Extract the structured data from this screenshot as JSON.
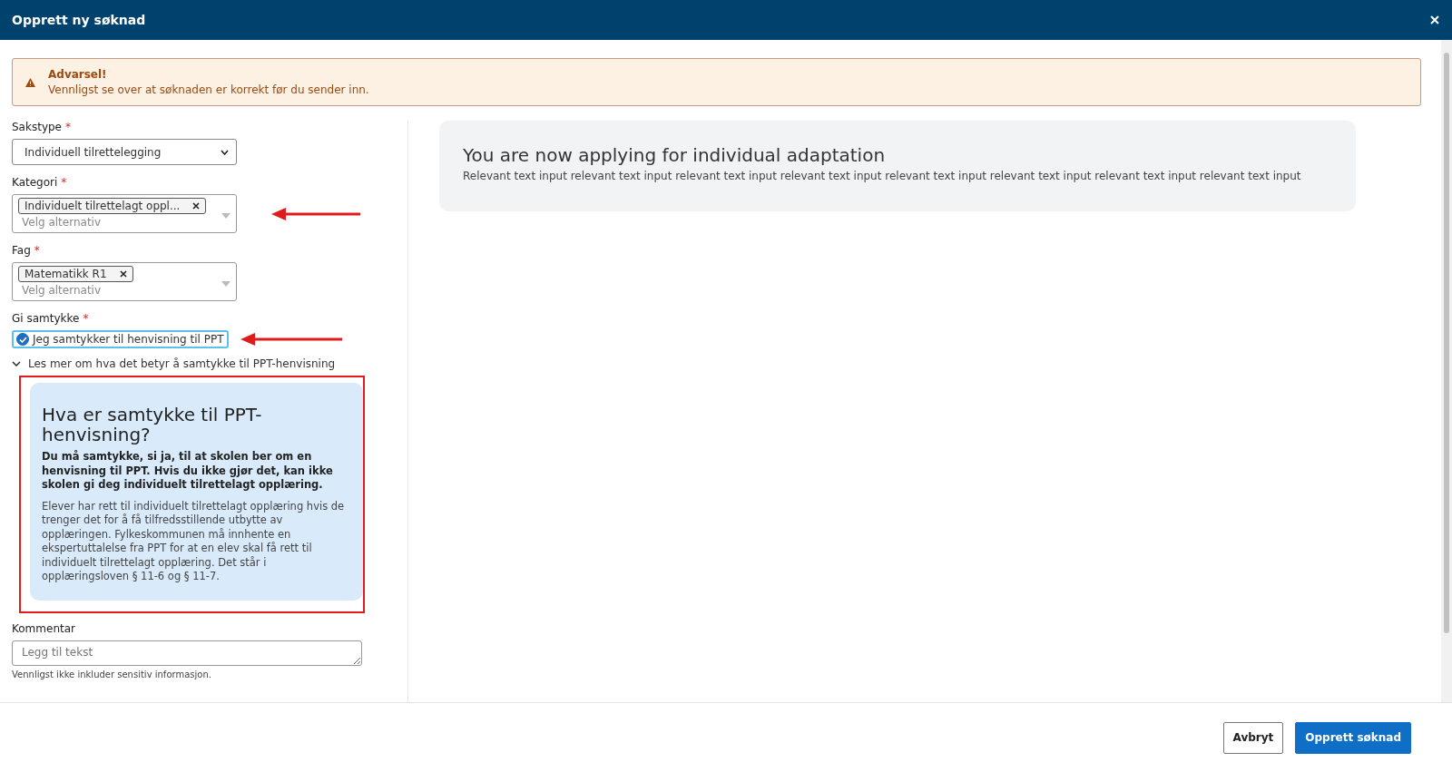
{
  "window": {
    "title": "Opprett ny søknad"
  },
  "alert": {
    "title": "Advarsel!",
    "message": "Vennligst se over at søknaden er korrekt før du sender inn."
  },
  "form": {
    "sakstype": {
      "label": "Sakstype",
      "required_mark": "*",
      "value": "Individuell tilrettelegging"
    },
    "kategori": {
      "label": "Kategori",
      "required_mark": "*",
      "tags": [
        "Individuelt tilrettelagt oppl..."
      ],
      "placeholder": "Velg alternativ"
    },
    "fag": {
      "label": "Fag",
      "required_mark": "*",
      "tags": [
        "Matematikk R1"
      ],
      "placeholder": "Velg alternativ"
    },
    "samtykke": {
      "label": "Gi samtykke",
      "required_mark": "*",
      "checkbox_label": "Jeg samtykker til henvisning til PPT",
      "checked": true
    },
    "info_toggle": {
      "label": "Les mer om hva det betyr å samtykke til PPT-henvisning",
      "expanded": true
    },
    "info": {
      "title": "Hva er samtykke til PPT-henvisning?",
      "lead": "Du må samtykke, si ja, til at skolen ber om en henvisning til PPT. Hvis du ikke gjør det, kan ikke skolen gi deg individuelt tilrettelagt opplæring.",
      "body": "Elever har rett til individuelt tilrettelagt opplæring hvis de trenger det for å få tilfredsstillende utbytte av opplæringen. Fylkeskommunen må innhente en ekspertuttalelse fra PPT for at en elev skal få rett til individuelt tilrettelagt opplæring. Det står i opplæringsloven § 11-6 og § 11-7."
    },
    "kommentar": {
      "label": "Kommentar",
      "placeholder": "Legg til tekst",
      "hint": "Vennligst ikke inkluder sensitiv informasjon."
    }
  },
  "panel": {
    "title": "You are now applying for individual adaptation",
    "text": "Relevant text input relevant text input relevant text input relevant text input relevant text input relevant text input relevant text input relevant text input"
  },
  "buttons": [
    {
      "label": "Avbryt",
      "kind": "secondary"
    },
    {
      "label": "Opprett søknad",
      "kind": "primary"
    }
  ]
}
